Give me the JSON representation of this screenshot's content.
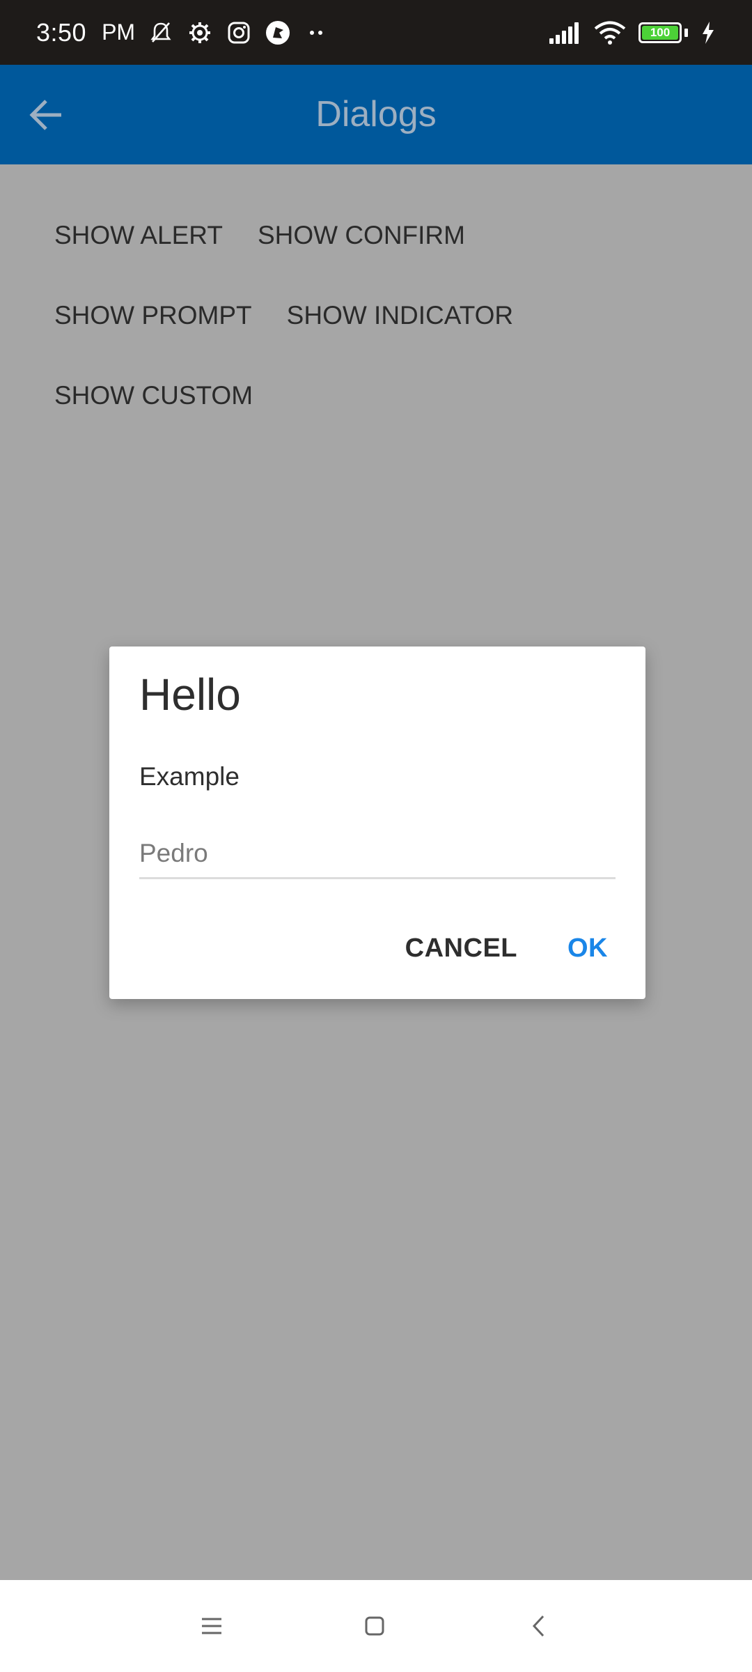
{
  "status_bar": {
    "time": "3:50",
    "ampm": "PM",
    "battery_level": "100",
    "icons": [
      "mute-bell-icon",
      "gear-icon",
      "instagram-icon",
      "app-icon",
      "more-dots-icon",
      "signal-icon",
      "wifi-icon",
      "battery-icon",
      "charging-bolt-icon"
    ]
  },
  "app_bar": {
    "title": "Dialogs",
    "back_icon": "arrow-back-icon"
  },
  "buttons": {
    "show_alert": "SHOW ALERT",
    "show_confirm": "SHOW CONFIRM",
    "show_prompt": "SHOW PROMPT",
    "show_indicator": "SHOW INDICATOR",
    "show_custom": "SHOW CUSTOM"
  },
  "dialog": {
    "title": "Hello",
    "message": "Example",
    "input_value": "Pedro",
    "cancel_label": "CANCEL",
    "ok_label": "OK"
  },
  "nav_bar": {
    "icons": [
      "menu-icon",
      "home-icon",
      "back-icon"
    ]
  },
  "colors": {
    "app_bar": "#00589b",
    "scrim_background": "#a6a6a6",
    "ok_accent": "#1a86e8",
    "status_bar": "#1e1b19"
  }
}
